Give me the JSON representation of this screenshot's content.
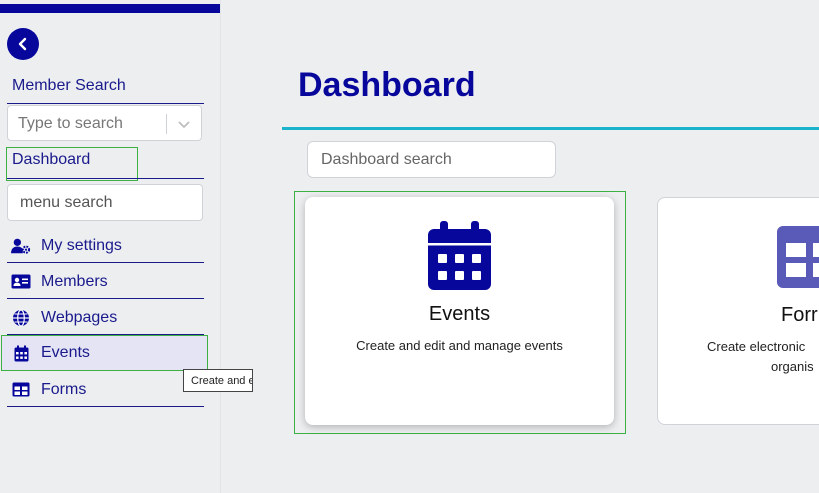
{
  "sidebar": {
    "member_search_label": "Member Search",
    "member_search_placeholder": "Type to search",
    "dashboard_label": "Dashboard",
    "menu_search_placeholder": "menu search",
    "items": [
      {
        "label": "My settings",
        "icon": "user-gear-icon"
      },
      {
        "label": "Members",
        "icon": "id-card-icon"
      },
      {
        "label": "Webpages",
        "icon": "globe-icon"
      },
      {
        "label": "Events",
        "icon": "calendar-icon"
      },
      {
        "label": "Forms",
        "icon": "table-icon"
      }
    ],
    "tooltip": "Create and e"
  },
  "main": {
    "title": "Dashboard",
    "search_placeholder": "Dashboard search",
    "cards": [
      {
        "title": "Events",
        "description": "Create and edit and manage events",
        "icon": "calendar-icon"
      },
      {
        "title": "Forr",
        "description_line1": "Create electronic",
        "description_line2": "organis",
        "icon": "table-icon"
      }
    ]
  },
  "colors": {
    "primary": "#07079b",
    "accent": "#19b4cc",
    "forms_icon": "#5a5ab8"
  }
}
